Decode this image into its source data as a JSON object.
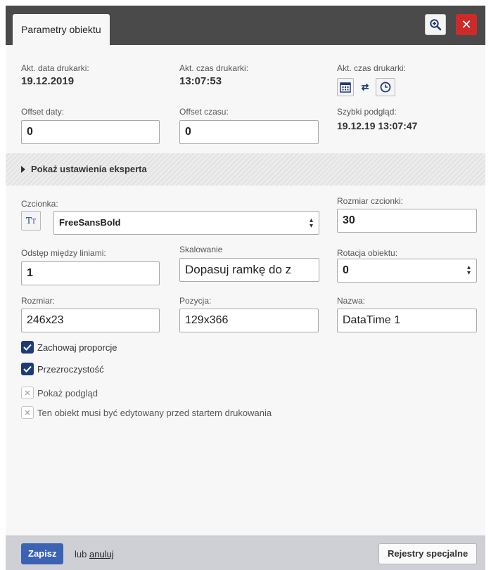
{
  "header": {
    "tab_title": "Parametry obiektu"
  },
  "printer": {
    "date_label": "Akt. data drukarki:",
    "date_value": "19.12.2019",
    "time_label": "Akt. czas drukarki:",
    "time_value": "13:07:53",
    "sync_label": "Akt. czas drukarki:"
  },
  "offsets": {
    "date_offset_label": "Offset daty:",
    "date_offset_value": "0",
    "time_offset_label": "Offset czasu:",
    "time_offset_value": "0",
    "preview_label": "Szybki podgląd:",
    "preview_value": "19.12.19 13:07:47"
  },
  "expert": {
    "label": "Pokaż ustawienia eksperta"
  },
  "font": {
    "label": "Czcionka:",
    "value": "FreeSansBold",
    "size_label": "Rozmiar czcionki:",
    "size_value": "30"
  },
  "layout": {
    "line_spacing_label": "Odstęp między liniami:",
    "line_spacing_value": "1",
    "scaling_label": "Skalowanie",
    "scaling_value": "Dopasuj ramkę do z",
    "rotation_label": "Rotacja obiektu:",
    "rotation_value": "0",
    "size_label": "Rozmiar:",
    "size_value": "246x23",
    "position_label": "Pozycja:",
    "position_value": "129x366",
    "name_label": "Nazwa:",
    "name_value": "DataTime 1"
  },
  "checkboxes": [
    {
      "label": "Zachowaj proporcje",
      "checked": true
    },
    {
      "label": "Przezroczystość",
      "checked": true
    },
    {
      "label": "Pokaż podgląd",
      "checked": false
    },
    {
      "label": "Ten obiekt musi być edytowany przed startem drukowania",
      "checked": false
    }
  ],
  "footer": {
    "save_label": "Zapisz",
    "or_text": "lub",
    "cancel_label": "anuluj",
    "special_label": "Rejestry specjalne"
  },
  "colors": {
    "save": "#3c62b4",
    "close": "#cf2a2a",
    "checked": "#1f3b73"
  },
  "icons": [
    "zoom-icon",
    "close-icon",
    "calendar-icon",
    "sync-icon",
    "clock-icon",
    "font-style-icon",
    "chevron-updown-icon",
    "check-icon",
    "x-icon",
    "triangle-right-icon"
  ]
}
